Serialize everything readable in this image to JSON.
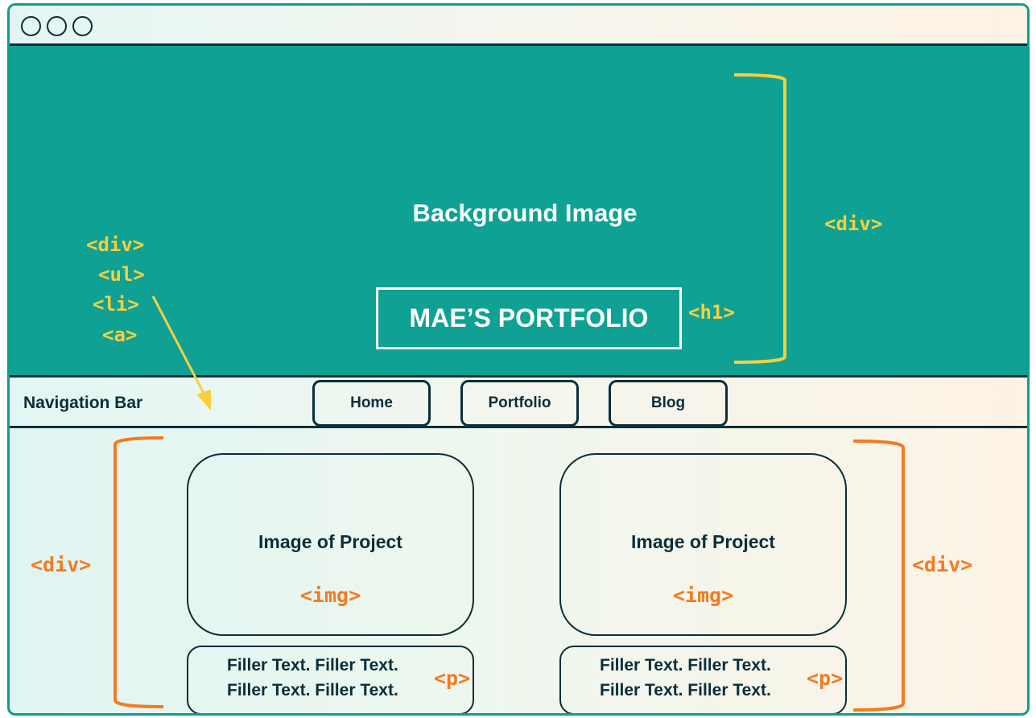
{
  "window": {
    "controls": [
      "circle",
      "circle",
      "circle"
    ]
  },
  "hero": {
    "title": "Background Image",
    "heading": "MAE’S PORTFOLIO",
    "heading_tag": "<h1>",
    "section_tag": "<div>"
  },
  "nav_tags": [
    "<div>",
    "<ul>",
    "<li>",
    "<a>"
  ],
  "navbar": {
    "label": "Navigation Bar",
    "items": [
      "Home",
      "Portfolio",
      "Blog"
    ]
  },
  "projects": {
    "left_tag": "<div>",
    "right_tag": "<div>",
    "cards": [
      {
        "title": "Image of Project",
        "img_tag": "<img>",
        "text_lines": [
          "Filler Text. Filler Text.",
          "Filler Text. Filler Text."
        ],
        "p_tag": "<p>"
      },
      {
        "title": "Image of Project",
        "img_tag": "<img>",
        "text_lines": [
          "Filler Text. Filler Text.",
          "Filler Text. Filler Text."
        ],
        "p_tag": "<p>"
      }
    ]
  },
  "colors": {
    "teal": "#0fa194",
    "dark": "#0a2e3a",
    "yellow": "#f7cf3c",
    "orange": "#f47b20"
  }
}
